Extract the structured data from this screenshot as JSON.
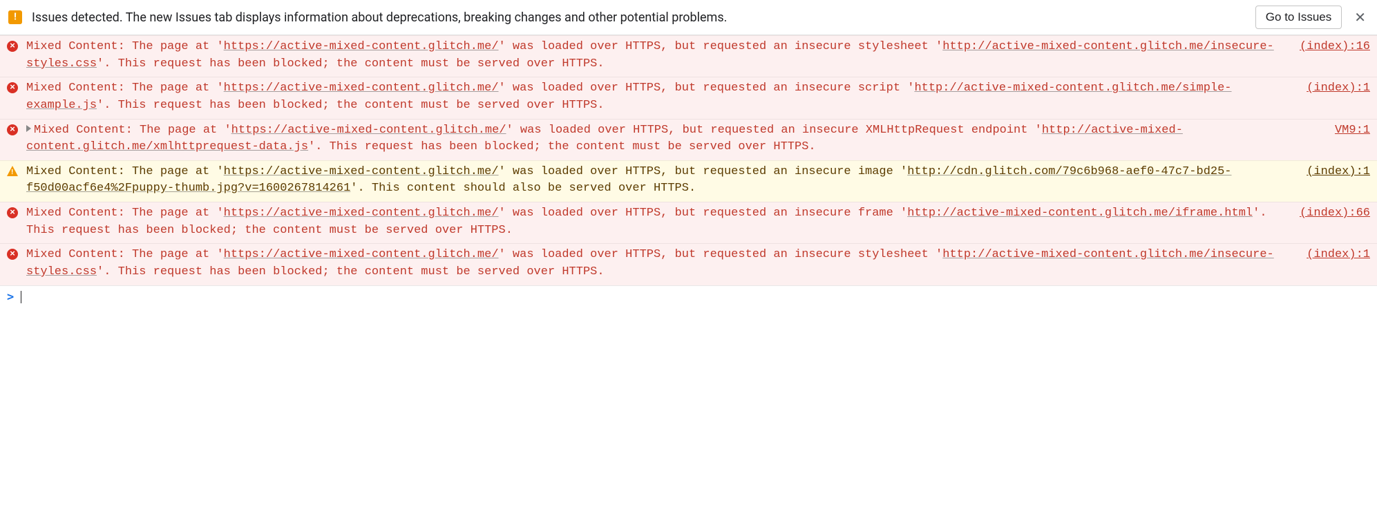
{
  "issues_bar": {
    "text": "Issues detected. The new Issues tab displays information about deprecations, breaking changes and other potential problems.",
    "button_label": "Go to Issues",
    "close_glyph": "✕"
  },
  "messages": [
    {
      "level": "error",
      "expandable": false,
      "prefix": "Mixed Content: The page at '",
      "url1": "https://active-mixed-content.glitch.me/",
      "mid": "' was loaded over HTTPS, but requested an insecure stylesheet '",
      "url2": "http://active-mixed-content.glitch.me/insecure-styles.css",
      "suffix": "'. This request has been blocked; the content must be served over HTTPS.",
      "source": "(index):16"
    },
    {
      "level": "error",
      "expandable": false,
      "prefix": "Mixed Content: The page at '",
      "url1": "https://active-mixed-content.glitch.me/",
      "mid": "' was loaded over HTTPS, but requested an insecure script '",
      "url2": "http://active-mixed-content.glitch.me/simple-example.js",
      "suffix": "'. This request has been blocked; the content must be served over HTTPS.",
      "source": "(index):1"
    },
    {
      "level": "error",
      "expandable": true,
      "prefix": "Mixed Content: The page at '",
      "url1": "https://active-mixed-content.glitch.me/",
      "mid": "' was loaded over HTTPS, but requested an insecure XMLHttpRequest endpoint '",
      "url2": "http://active-mixed-content.glitch.me/xmlhttprequest-data.js",
      "suffix": "'. This request has been blocked; the content must be served over HTTPS.",
      "source": "VM9:1"
    },
    {
      "level": "warning",
      "expandable": false,
      "prefix": "Mixed Content: The page at '",
      "url1": "https://active-mixed-content.glitch.me/",
      "mid": "' was loaded over HTTPS, but requested an insecure image '",
      "url2": "http://cdn.glitch.com/79c6b968-aef0-47c7-bd25-f50d00acf6e4%2Fpuppy-thumb.jpg?v=1600267814261",
      "suffix": "'. This content should also be served over HTTPS.",
      "source": "(index):1"
    },
    {
      "level": "error",
      "expandable": false,
      "prefix": "Mixed Content: The page at '",
      "url1": "https://active-mixed-content.glitch.me/",
      "mid": "' was loaded over HTTPS, but requested an insecure frame '",
      "url2": "http://active-mixed-content.glitch.me/iframe.html",
      "suffix": "'. This request has been blocked; the content must be served over HTTPS.",
      "source": "(index):66"
    },
    {
      "level": "error",
      "expandable": false,
      "prefix": "Mixed Content: The page at '",
      "url1": "https://active-mixed-content.glitch.me/",
      "mid": "' was loaded over HTTPS, but requested an insecure stylesheet '",
      "url2": "http://active-mixed-content.glitch.me/insecure-styles.css",
      "suffix": "'. This request has been blocked; the content must be served over HTTPS.",
      "source": "(index):1"
    }
  ]
}
